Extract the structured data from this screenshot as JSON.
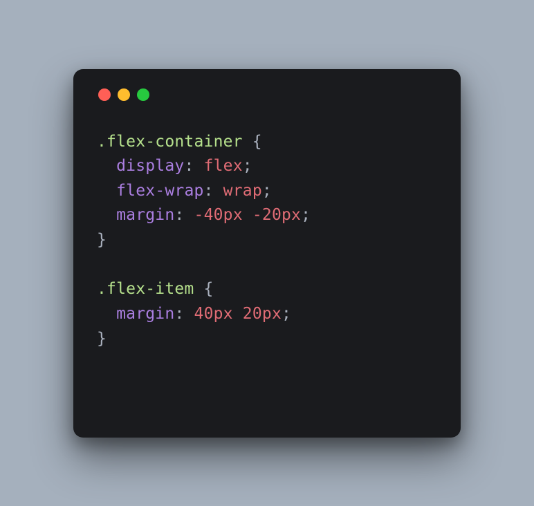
{
  "window": {
    "traffic_lights": {
      "red": "#ff5f56",
      "yellow": "#ffbd2e",
      "green": "#27c93f"
    }
  },
  "code": {
    "indent": "  ",
    "rules": [
      {
        "selector": ".flex-container",
        "declarations": [
          {
            "property": "display",
            "value_tokens": [
              {
                "text": "flex",
                "kind": "valkw"
              }
            ]
          },
          {
            "property": "flex-wrap",
            "value_tokens": [
              {
                "text": "wrap",
                "kind": "valkw"
              }
            ]
          },
          {
            "property": "margin",
            "value_tokens": [
              {
                "text": "-40px",
                "kind": "num"
              },
              {
                "text": " ",
                "kind": "punc"
              },
              {
                "text": "-20px",
                "kind": "num"
              }
            ]
          }
        ]
      },
      {
        "selector": ".flex-item",
        "declarations": [
          {
            "property": "margin",
            "value_tokens": [
              {
                "text": "40px",
                "kind": "num"
              },
              {
                "text": " ",
                "kind": "punc"
              },
              {
                "text": "20px",
                "kind": "num"
              }
            ]
          }
        ]
      }
    ],
    "brace_open": "{",
    "brace_close": "}",
    "colon": ":",
    "semicolon": ";",
    "space": " "
  }
}
